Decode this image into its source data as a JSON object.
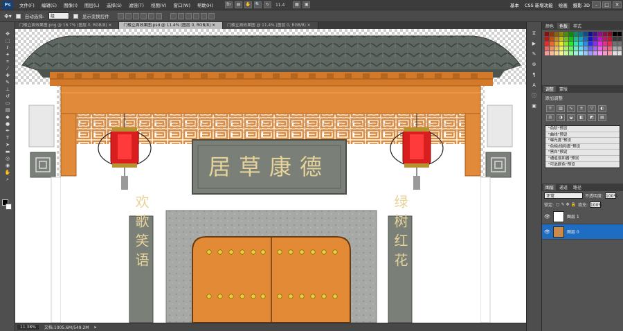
{
  "app": {
    "logo": "Ps"
  },
  "menu": [
    "文件(F)",
    "编辑(E)",
    "图像(I)",
    "图层(L)",
    "选择(S)",
    "滤镜(T)",
    "视图(V)",
    "窗口(W)",
    "帮助(H)"
  ],
  "menubar_zoom": "11.4",
  "workspace": [
    "基本",
    "CSS 新增功能",
    "绘画",
    "摄影 3D"
  ],
  "window_controls": [
    "–",
    "□",
    "✕"
  ],
  "options": {
    "auto_select_label": "自动选择:",
    "auto_select_value": "组",
    "show_transform_label": "显示变换控件"
  },
  "tabs": [
    {
      "label": "门楼立面效果图.png @ 16.7% (图层 0, RGB/8) ✕"
    },
    {
      "label": "门楼立面效果图.psd @ 11.4% (图层 0, RGB/8) ✕"
    },
    {
      "label": "门楼立面效果图 @ 11.4% (图层 0, RGB/8) ✕"
    }
  ],
  "canvas": {
    "plaque_text": "居草康德",
    "couplet_left": "欢歌笑语",
    "couplet_right": "绿树红花"
  },
  "status": {
    "zoom": "11.38%",
    "doc": "文档:1005.6M/549.2M"
  },
  "panels": {
    "color_tabs": [
      "颜色",
      "色板",
      "样式"
    ],
    "adjust_title": "添加调整",
    "adjust_tabs": [
      "调整",
      "蒙版"
    ],
    "presets": [
      "\"色阶\"预设",
      "\"曲线\"预设",
      "\"曝光度\"预设",
      "\"色相/饱和度\"预设",
      "\"黑白\"预设",
      "\"通道混和器\"预设",
      "\"可选颜色\"预设"
    ],
    "layer_tabs": [
      "图层",
      "通道",
      "路径"
    ],
    "blend_mode": "正常",
    "opacity_label": "不透明度:",
    "opacity_value": "100%",
    "lock_label": "锁定:",
    "fill_label": "填充:",
    "fill_value": "100%",
    "layers": [
      {
        "name": "图层 1"
      },
      {
        "name": "图层 0"
      }
    ]
  },
  "colors": {
    "eave_orange": "#E08A3A",
    "lantern_red": "#D81E1E",
    "tile_gray": "#5E6660",
    "plaque_gray": "#7A7F78",
    "door_orange": "#E28A36",
    "highlight": "#1F6DC2"
  }
}
